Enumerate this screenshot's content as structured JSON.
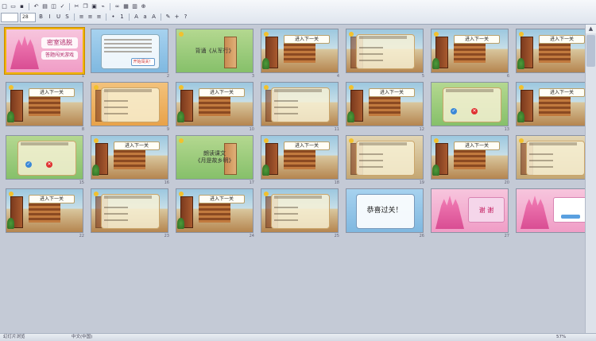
{
  "toolbar": {
    "row1_icons": [
      "new-icon",
      "open-icon",
      "save-icon",
      "undo-icon",
      "print-icon",
      "preview-icon",
      "spell-icon",
      "cut-icon",
      "copy-icon",
      "paste-icon",
      "format-painter-icon",
      "hyperlink-icon",
      "table-icon",
      "chart-icon",
      "zoom-icon"
    ],
    "font_name": "",
    "font_size": "28",
    "row2_icons": [
      "bold-icon",
      "italic-icon",
      "underline-icon",
      "shadow-icon",
      "align-left-icon",
      "center-icon",
      "align-right-icon",
      "bullets-icon",
      "numbering-icon",
      "increase-font-icon",
      "decrease-font-icon",
      "font-color-icon",
      "design-icon",
      "new-slide-icon",
      "help-icon"
    ]
  },
  "slides": [
    {
      "num": "1",
      "kind": "title-pink",
      "title": "密室逃脱",
      "subtitle": "答题闯关游戏"
    },
    {
      "num": "2",
      "kind": "rules-blue",
      "button": "开始闯关！"
    },
    {
      "num": "3",
      "kind": "green-card",
      "text": "背诵《从军行》"
    },
    {
      "num": "4",
      "kind": "room",
      "banner": "进入下一关"
    },
    {
      "num": "5",
      "kind": "question-room"
    },
    {
      "num": "6",
      "kind": "room",
      "banner": "进入下一关"
    },
    {
      "num": "7",
      "kind": "room",
      "banner": "进入下一关"
    },
    {
      "num": "8",
      "kind": "room",
      "banner": "进入下一关"
    },
    {
      "num": "9",
      "kind": "question-orange"
    },
    {
      "num": "10",
      "kind": "room",
      "banner": "进入下一关"
    },
    {
      "num": "11",
      "kind": "question-room"
    },
    {
      "num": "12",
      "kind": "room",
      "banner": "进入下一关"
    },
    {
      "num": "13",
      "kind": "answer-green"
    },
    {
      "num": "14",
      "kind": "room",
      "banner": "进入下一关"
    },
    {
      "num": "15",
      "kind": "answer-green"
    },
    {
      "num": "16",
      "kind": "room",
      "banner": "进入下一关"
    },
    {
      "num": "17",
      "kind": "green-card",
      "text": "朗读课文\n《月是故乡明》"
    },
    {
      "num": "18",
      "kind": "room",
      "banner": "进入下一关"
    },
    {
      "num": "19",
      "kind": "question-attic"
    },
    {
      "num": "20",
      "kind": "room",
      "banner": "进入下一关"
    },
    {
      "num": "21",
      "kind": "question-attic"
    },
    {
      "num": "22",
      "kind": "room",
      "banner": "进入下一关"
    },
    {
      "num": "23",
      "kind": "question-room"
    },
    {
      "num": "24",
      "kind": "room",
      "banner": "进入下一关"
    },
    {
      "num": "25",
      "kind": "question-room"
    },
    {
      "num": "26",
      "kind": "congrats",
      "text": "恭喜过关！"
    },
    {
      "num": "27",
      "kind": "thanks-pink",
      "text": "谢 谢"
    },
    {
      "num": "28",
      "kind": "thanks-pink2",
      "text": ""
    }
  ],
  "statusbar": {
    "left": "幻灯片浏览",
    "mid": "中文(中国)",
    "zoom": "57%"
  }
}
